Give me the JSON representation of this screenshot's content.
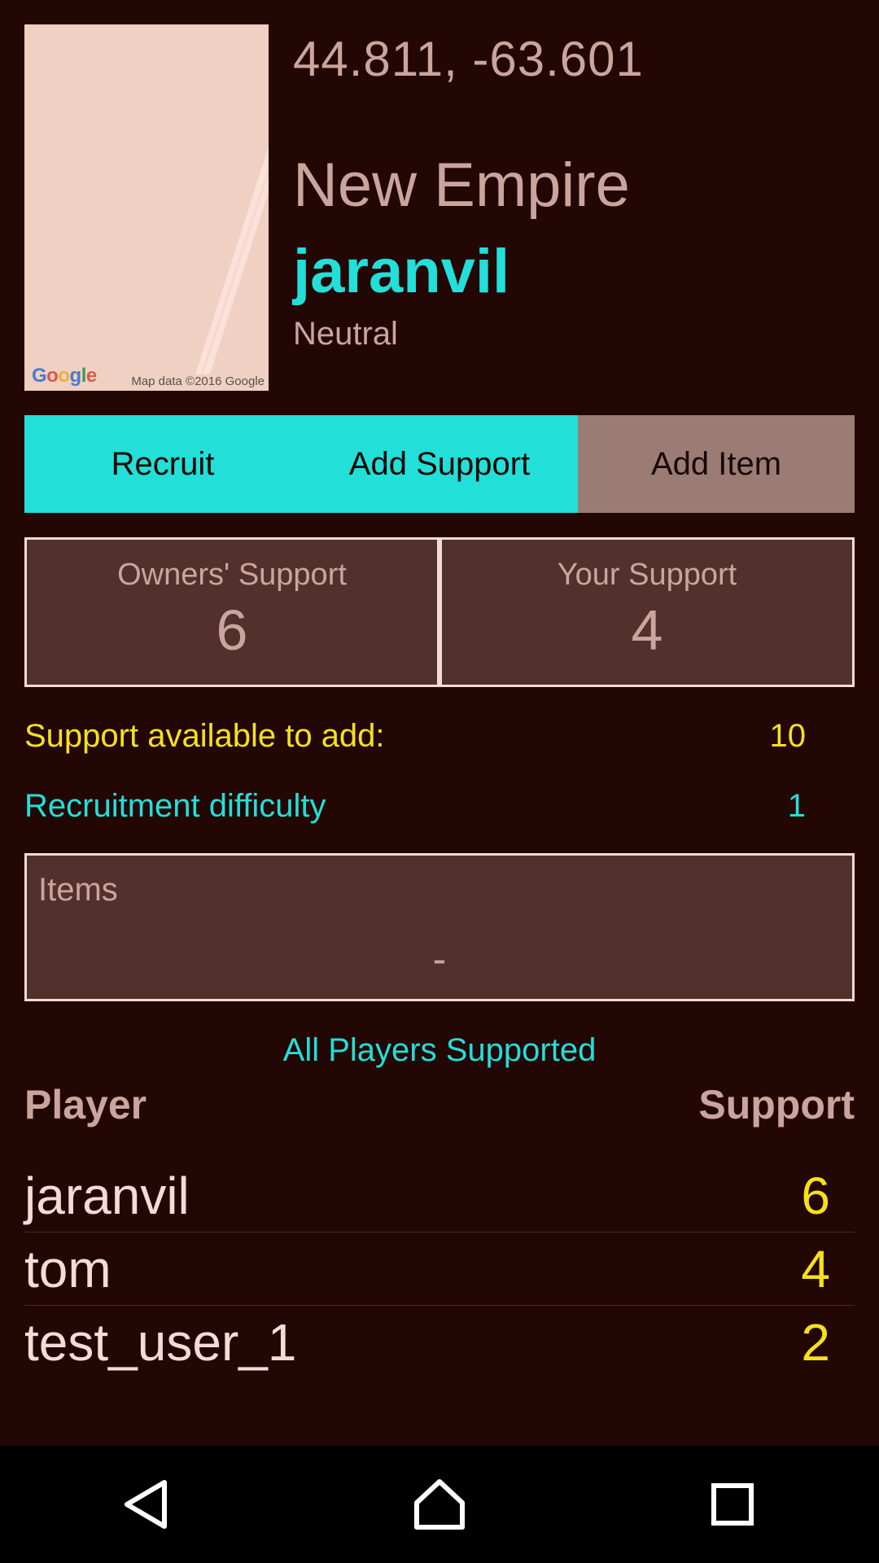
{
  "map": {
    "logo": "Google",
    "attribution": "Map data ©2016 Google"
  },
  "header": {
    "coordinates": "44.811, -63.601",
    "empire_name": "New Empire",
    "owner_name": "jaranvil",
    "alignment": "Neutral"
  },
  "actions": {
    "recruit": "Recruit",
    "add_support": "Add Support",
    "add_item": "Add Item"
  },
  "support": {
    "owners_label": "Owners' Support",
    "owners_value": "6",
    "yours_label": "Your Support",
    "yours_value": "4"
  },
  "stats": {
    "available_label": "Support available to add:",
    "available_value": "10",
    "difficulty_label": "Recruitment difficulty",
    "difficulty_value": "1"
  },
  "items": {
    "label": "Items",
    "value": "-"
  },
  "players": {
    "title": "All Players Supported",
    "col_player": "Player",
    "col_support": "Support",
    "rows": [
      {
        "name": "jaranvil",
        "support": "6"
      },
      {
        "name": "tom",
        "support": "4"
      },
      {
        "name": "test_user_1",
        "support": "2"
      }
    ]
  },
  "colors": {
    "background": "#230705",
    "accent_cyan": "#22dfd8",
    "accent_yellow": "#f5e11a",
    "muted_text": "#caa59d",
    "panel": "#52302c",
    "button_disabled": "#9a7c75"
  },
  "navbar": {
    "icons": [
      "back-icon",
      "home-icon",
      "recents-icon"
    ]
  }
}
